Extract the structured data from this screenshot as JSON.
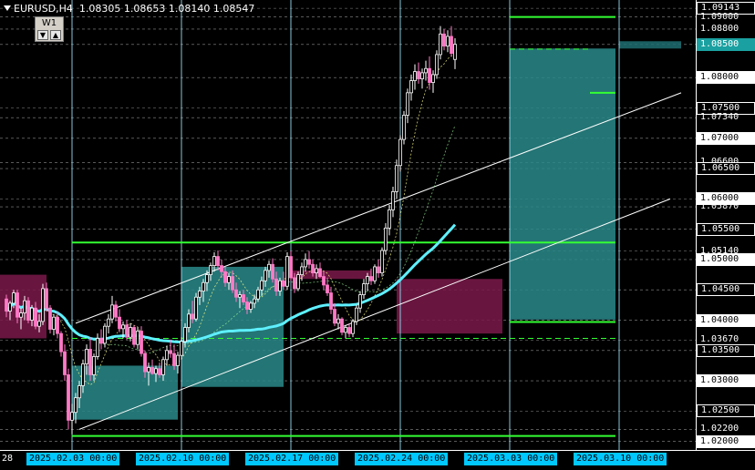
{
  "header": {
    "symbol": "EURUSD,H4",
    "ohlc": "1.08305 1.08653 1.08140 1.08547"
  },
  "timeframe_box": {
    "label": "W1",
    "down_btn": "▼",
    "up_btn": "▲"
  },
  "price_axis": [
    {
      "text": "1.09143",
      "price": 1.09143,
      "style": "box"
    },
    {
      "text": "1.09000",
      "price": 1.09,
      "style": "plain"
    },
    {
      "text": "1.08800",
      "price": 1.088,
      "style": "plain"
    },
    {
      "text": "1.08500",
      "price": 1.08547,
      "style": "cur"
    },
    {
      "text": "1.08000",
      "price": 1.08,
      "style": "hl"
    },
    {
      "text": "1.07500",
      "price": 1.075,
      "style": "box"
    },
    {
      "text": "1.07340",
      "price": 1.0734,
      "style": "plain"
    },
    {
      "text": "1.07000",
      "price": 1.07,
      "style": "hl"
    },
    {
      "text": "1.06600",
      "price": 1.066,
      "style": "plain"
    },
    {
      "text": "1.06500",
      "price": 1.065,
      "style": "box"
    },
    {
      "text": "1.06000",
      "price": 1.06,
      "style": "hl"
    },
    {
      "text": "1.05870",
      "price": 1.0587,
      "style": "plain"
    },
    {
      "text": "1.05500",
      "price": 1.055,
      "style": "box"
    },
    {
      "text": "1.05140",
      "price": 1.0514,
      "style": "plain"
    },
    {
      "text": "1.05000",
      "price": 1.05,
      "style": "hl"
    },
    {
      "text": "1.04500",
      "price": 1.045,
      "style": "box"
    },
    {
      "text": "1.04000",
      "price": 1.04,
      "style": "hl"
    },
    {
      "text": "1.03670",
      "price": 1.0367,
      "style": "plain"
    },
    {
      "text": "1.03500",
      "price": 1.035,
      "style": "box"
    },
    {
      "text": "1.03000",
      "price": 1.03,
      "style": "hl"
    },
    {
      "text": "1.02500",
      "price": 1.025,
      "style": "box"
    },
    {
      "text": "1.02200",
      "price": 1.022,
      "style": "plain"
    },
    {
      "text": "1.02000",
      "price": 1.02,
      "style": "hl"
    }
  ],
  "time_axis": [
    {
      "text": "28",
      "bar": 0,
      "style": "plain"
    },
    {
      "text": "2025.02.03 00:00",
      "bar": 18,
      "style": "b"
    },
    {
      "text": "2025.02.10 00:00",
      "bar": 48,
      "style": "b"
    },
    {
      "text": "2025.02.17 00:00",
      "bar": 78,
      "style": "b"
    },
    {
      "text": "2025.02.24 00:00",
      "bar": 108,
      "style": "b"
    },
    {
      "text": "2025.03.03 00:00",
      "bar": 138,
      "style": "b"
    },
    {
      "text": "2025.03.10 00:00",
      "bar": 168,
      "style": "b"
    }
  ],
  "chart_data": {
    "type": "candlestick",
    "symbol": "EURUSD",
    "timeframe": "H4",
    "ylim": [
      1.0192,
      1.0922
    ],
    "grid": true,
    "candles": [
      [
        1.0435,
        1.0442,
        1.0405,
        1.0415
      ],
      [
        1.0415,
        1.0432,
        1.04,
        1.0428
      ],
      [
        1.0428,
        1.045,
        1.042,
        1.0445
      ],
      [
        1.0445,
        1.045,
        1.0395,
        1.0405
      ],
      [
        1.0405,
        1.042,
        1.0385,
        1.0412
      ],
      [
        1.0412,
        1.044,
        1.04,
        1.0432
      ],
      [
        1.0432,
        1.0438,
        1.0395,
        1.04
      ],
      [
        1.04,
        1.0425,
        1.039,
        1.042
      ],
      [
        1.042,
        1.043,
        1.0385,
        1.039
      ],
      [
        1.039,
        1.041,
        1.038,
        1.0398
      ],
      [
        1.0398,
        1.046,
        1.0392,
        1.0452
      ],
      [
        1.0452,
        1.0462,
        1.0415,
        1.042
      ],
      [
        1.042,
        1.0425,
        1.0378,
        1.0385
      ],
      [
        1.0385,
        1.041,
        1.0375,
        1.0405
      ],
      [
        1.0405,
        1.0415,
        1.037,
        1.0378
      ],
      [
        1.0378,
        1.0382,
        1.034,
        1.0348
      ],
      [
        1.0348,
        1.036,
        1.03,
        1.031
      ],
      [
        1.031,
        1.032,
        1.022,
        1.0235
      ],
      [
        1.0235,
        1.0262,
        1.0212,
        1.0248
      ],
      [
        1.0248,
        1.028,
        1.023,
        1.0272
      ],
      [
        1.0272,
        1.03,
        1.0255,
        1.0292
      ],
      [
        1.0292,
        1.0335,
        1.028,
        1.0328
      ],
      [
        1.0328,
        1.036,
        1.031,
        1.0352
      ],
      [
        1.0352,
        1.0372,
        1.03,
        1.031
      ],
      [
        1.031,
        1.0345,
        1.03,
        1.034
      ],
      [
        1.034,
        1.0378,
        1.0335,
        1.037
      ],
      [
        1.037,
        1.0385,
        1.0352,
        1.0362
      ],
      [
        1.0362,
        1.0395,
        1.0355,
        1.039
      ],
      [
        1.039,
        1.041,
        1.0378,
        1.0402
      ],
      [
        1.0402,
        1.044,
        1.0395,
        1.0425
      ],
      [
        1.0425,
        1.0432,
        1.0398,
        1.0405
      ],
      [
        1.0405,
        1.0418,
        1.038,
        1.0386
      ],
      [
        1.0386,
        1.0398,
        1.037,
        1.0392
      ],
      [
        1.0392,
        1.04,
        1.0368,
        1.0372
      ],
      [
        1.0372,
        1.0395,
        1.0365,
        1.0388
      ],
      [
        1.0388,
        1.0392,
        1.0355,
        1.036
      ],
      [
        1.036,
        1.0388,
        1.0352,
        1.0382
      ],
      [
        1.0382,
        1.039,
        1.034,
        1.0345
      ],
      [
        1.0345,
        1.035,
        1.0305,
        1.0315
      ],
      [
        1.0315,
        1.033,
        1.0292,
        1.0322
      ],
      [
        1.0322,
        1.0335,
        1.031,
        1.0312
      ],
      [
        1.0312,
        1.0325,
        1.0298,
        1.032
      ],
      [
        1.032,
        1.033,
        1.0305,
        1.031
      ],
      [
        1.031,
        1.034,
        1.03,
        1.0335
      ],
      [
        1.0335,
        1.0358,
        1.0325,
        1.035
      ],
      [
        1.035,
        1.0368,
        1.0338,
        1.0345
      ],
      [
        1.0345,
        1.036,
        1.0318,
        1.0325
      ],
      [
        1.0325,
        1.0348,
        1.0312,
        1.0342
      ],
      [
        1.0342,
        1.0372,
        1.0335,
        1.0365
      ],
      [
        1.0365,
        1.0395,
        1.0355,
        1.0388
      ],
      [
        1.0388,
        1.0418,
        1.038,
        1.041
      ],
      [
        1.041,
        1.0432,
        1.0395,
        1.0402
      ],
      [
        1.0402,
        1.0445,
        1.0398,
        1.0438
      ],
      [
        1.0438,
        1.0455,
        1.0425,
        1.0448
      ],
      [
        1.0448,
        1.0468,
        1.043,
        1.0462
      ],
      [
        1.0462,
        1.0482,
        1.0448,
        1.0475
      ],
      [
        1.0475,
        1.0495,
        1.0465,
        1.049
      ],
      [
        1.049,
        1.0512,
        1.048,
        1.0505
      ],
      [
        1.0505,
        1.0515,
        1.0482,
        1.049
      ],
      [
        1.049,
        1.05,
        1.047,
        1.048
      ],
      [
        1.048,
        1.0488,
        1.0455,
        1.0462
      ],
      [
        1.0462,
        1.0478,
        1.045,
        1.0472
      ],
      [
        1.0472,
        1.0482,
        1.0445,
        1.045
      ],
      [
        1.045,
        1.0462,
        1.043,
        1.0438
      ],
      [
        1.0438,
        1.0448,
        1.042,
        1.0442
      ],
      [
        1.0442,
        1.045,
        1.0425,
        1.043
      ],
      [
        1.043,
        1.0438,
        1.041,
        1.0418
      ],
      [
        1.0418,
        1.0432,
        1.0412,
        1.0428
      ],
      [
        1.0428,
        1.0442,
        1.042,
        1.0435
      ],
      [
        1.0435,
        1.0455,
        1.043,
        1.045
      ],
      [
        1.045,
        1.0472,
        1.044,
        1.0465
      ],
      [
        1.0465,
        1.0488,
        1.0455,
        1.0482
      ],
      [
        1.0482,
        1.0498,
        1.047,
        1.0492
      ],
      [
        1.0492,
        1.0502,
        1.0462,
        1.0468
      ],
      [
        1.0468,
        1.048,
        1.044,
        1.0448
      ],
      [
        1.0448,
        1.047,
        1.044,
        1.0465
      ],
      [
        1.0465,
        1.048,
        1.045,
        1.0456
      ],
      [
        1.0456,
        1.0512,
        1.045,
        1.0505
      ],
      [
        1.0505,
        1.0514,
        1.0465,
        1.047
      ],
      [
        1.047,
        1.0478,
        1.0445,
        1.0452
      ],
      [
        1.0452,
        1.048,
        1.0448,
        1.0475
      ],
      [
        1.0475,
        1.0495,
        1.0465,
        1.0488
      ],
      [
        1.0488,
        1.051,
        1.048,
        1.05
      ],
      [
        1.05,
        1.0514,
        1.0485,
        1.0492
      ],
      [
        1.0492,
        1.05,
        1.0472,
        1.0478
      ],
      [
        1.0478,
        1.0492,
        1.0468,
        1.0485
      ],
      [
        1.0485,
        1.0495,
        1.047,
        1.0472
      ],
      [
        1.0472,
        1.048,
        1.045,
        1.0458
      ],
      [
        1.0458,
        1.047,
        1.044,
        1.0445
      ],
      [
        1.0445,
        1.0455,
        1.041,
        1.0418
      ],
      [
        1.0418,
        1.0428,
        1.039,
        1.0395
      ],
      [
        1.0395,
        1.041,
        1.0385,
        1.0402
      ],
      [
        1.0402,
        1.0405,
        1.0375,
        1.038
      ],
      [
        1.038,
        1.0392,
        1.037,
        1.0388
      ],
      [
        1.0388,
        1.0395,
        1.0372,
        1.0378
      ],
      [
        1.0378,
        1.0402,
        1.0372,
        1.0398
      ],
      [
        1.0398,
        1.0425,
        1.0392,
        1.042
      ],
      [
        1.042,
        1.0448,
        1.0412,
        1.0442
      ],
      [
        1.0442,
        1.0468,
        1.0435,
        1.046
      ],
      [
        1.046,
        1.0478,
        1.0448,
        1.0472
      ],
      [
        1.0472,
        1.0485,
        1.0458,
        1.0465
      ],
      [
        1.0465,
        1.0492,
        1.046,
        1.0488
      ],
      [
        1.0488,
        1.05,
        1.047,
        1.0478
      ],
      [
        1.0478,
        1.052,
        1.0472,
        1.0515
      ],
      [
        1.0515,
        1.056,
        1.0508,
        1.0552
      ],
      [
        1.0552,
        1.059,
        1.054,
        1.0582
      ],
      [
        1.0582,
        1.062,
        1.057,
        1.0612
      ],
      [
        1.0612,
        1.0665,
        1.06,
        1.0655
      ],
      [
        1.0655,
        1.0705,
        1.0645,
        1.0698
      ],
      [
        1.0698,
        1.0745,
        1.069,
        1.0738
      ],
      [
        1.0738,
        1.0782,
        1.0725,
        1.0775
      ],
      [
        1.0775,
        1.0805,
        1.0762,
        1.0795
      ],
      [
        1.0795,
        1.0822,
        1.078,
        1.081
      ],
      [
        1.081,
        1.0825,
        1.079,
        1.0798
      ],
      [
        1.0798,
        1.0815,
        1.0782,
        1.0808
      ],
      [
        1.0808,
        1.0828,
        1.0795,
        1.0815
      ],
      [
        1.0815,
        1.0835,
        1.078,
        1.0792
      ],
      [
        1.0792,
        1.0812,
        1.0775,
        1.0805
      ],
      [
        1.0805,
        1.0845,
        1.0798,
        1.0838
      ],
      [
        1.0838,
        1.0885,
        1.083,
        1.0872
      ],
      [
        1.0872,
        1.088,
        1.0845,
        1.0852
      ],
      [
        1.0852,
        1.0878,
        1.0842,
        1.0868
      ],
      [
        1.0868,
        1.0885,
        1.0835,
        1.084
      ],
      [
        1.083,
        1.0865,
        1.0814,
        1.0855
      ]
    ]
  }
}
